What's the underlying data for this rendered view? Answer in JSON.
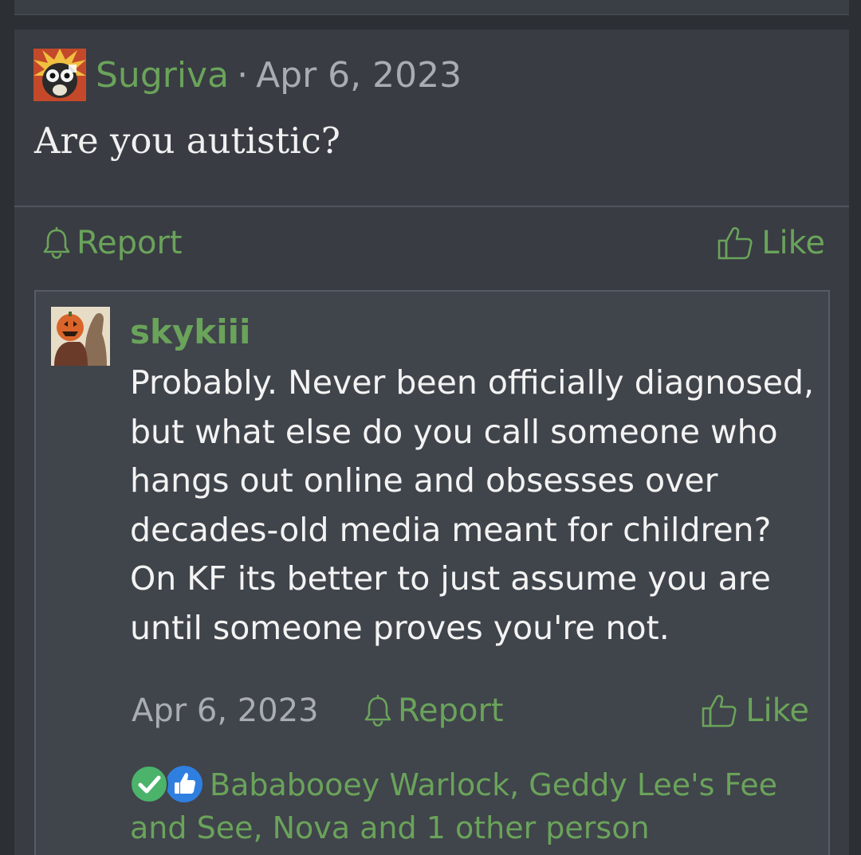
{
  "post": {
    "author": "Sugriva",
    "separator": "·",
    "date": "Apr 6, 2023",
    "body": "Are you autistic?",
    "report_label": "Report",
    "like_label": "Like"
  },
  "quote": {
    "author": "skykiii",
    "text": "Probably. Never been officially diagnosed, but what else do you call someone who hangs out online and obsesses over decades-old media meant for children? On KF its better to just assume you are until someone proves you're not.",
    "date": "Apr 6, 2023",
    "report_label": "Report",
    "like_label": "Like",
    "reactions_text": "Bababooey Warlock, Geddy Lee's Fee and See, Nova and 1 other person"
  },
  "colors": {
    "accent": "#6aa35a",
    "panel": "#393c43",
    "quote_panel": "#40444b",
    "muted_text": "#a9acb2"
  },
  "icons": [
    "bell-icon",
    "thumbs-up-outline-icon",
    "checkmark-reaction-icon",
    "thumbs-up-reaction-icon"
  ]
}
